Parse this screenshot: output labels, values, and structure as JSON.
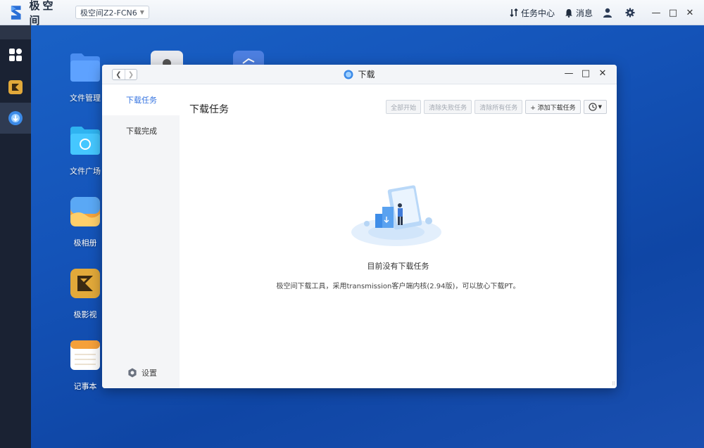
{
  "topbar": {
    "brand": "极空间",
    "device": "极空间Z2-FCN6",
    "task_center": "任务中心",
    "messages": "消息"
  },
  "desktop": {
    "icons": [
      {
        "label": "文件管理"
      },
      {
        "label": "文件广场"
      },
      {
        "label": "极相册"
      },
      {
        "label": "极影视"
      },
      {
        "label": "记事本"
      }
    ]
  },
  "window": {
    "title": "下载",
    "sidebar": {
      "items": [
        {
          "label": "下载任务"
        },
        {
          "label": "下载完成"
        }
      ],
      "settings": "设置"
    },
    "content_title": "下载任务",
    "toolbar": {
      "start_all": "全部开始",
      "clear_failed": "清除失败任务",
      "clear_all": "清除所有任务",
      "add_task": "+ 添加下载任务"
    },
    "empty_title": "目前没有下载任务",
    "empty_desc": "极空间下载工具，采用transmission客户端内核(2.94版)，可以放心下载PT。"
  },
  "colors": {
    "accent": "#3473e0",
    "dock": "#1a2233",
    "desktop": "#1453b8"
  }
}
